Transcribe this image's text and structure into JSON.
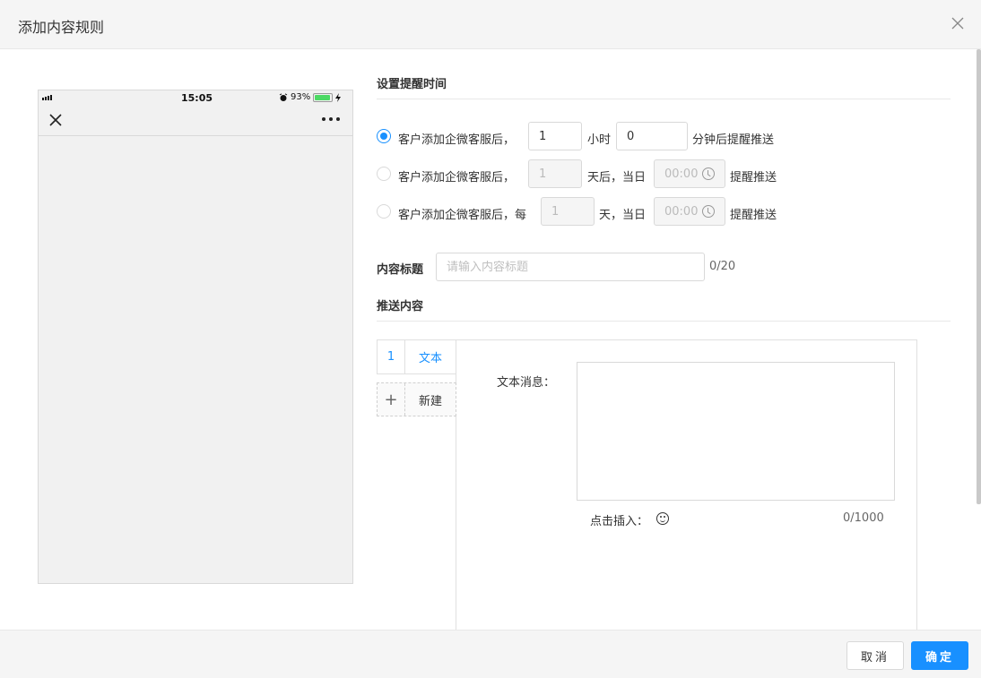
{
  "dialog": {
    "title": "添加内容规则"
  },
  "phone": {
    "time": "15:05",
    "battery": "93%"
  },
  "reminder": {
    "section_title": "设置提醒时间",
    "option1": {
      "prefix": "客户添加企微客服后，",
      "hours": "1",
      "hours_unit": "小时",
      "minutes": "0",
      "suffix": "分钟后提醒推送",
      "selected": true
    },
    "option2": {
      "prefix": "客户添加企微客服后，",
      "days": "1",
      "days_unit": "天后，当日",
      "time": "00:00",
      "suffix": "提醒推送",
      "selected": false
    },
    "option3": {
      "prefix": "客户添加企微客服后，每",
      "days": "1",
      "days_unit": "天，当日",
      "time": "00:00",
      "suffix": "提醒推送",
      "selected": false
    }
  },
  "content_title": {
    "label": "内容标题",
    "placeholder": "请输入内容标题",
    "counter": "0/20"
  },
  "push_content": {
    "section_title": "推送内容",
    "tabs": [
      {
        "num": "1",
        "label": "文本"
      }
    ],
    "new_tab": {
      "icon": "+",
      "label": "新建"
    },
    "message_label": "文本消息：",
    "insert_label": "点击插入：",
    "counter": "0/1000"
  },
  "footer": {
    "cancel": "取消",
    "confirm": "确定"
  },
  "colors": {
    "accent": "#1890ff",
    "battery": "#4cd964"
  },
  "icons": [
    "close-icon",
    "signal-icon",
    "alarm-icon",
    "battery-icon",
    "charging-icon",
    "more-icon",
    "clock-icon",
    "plus-icon",
    "emoji-icon"
  ]
}
